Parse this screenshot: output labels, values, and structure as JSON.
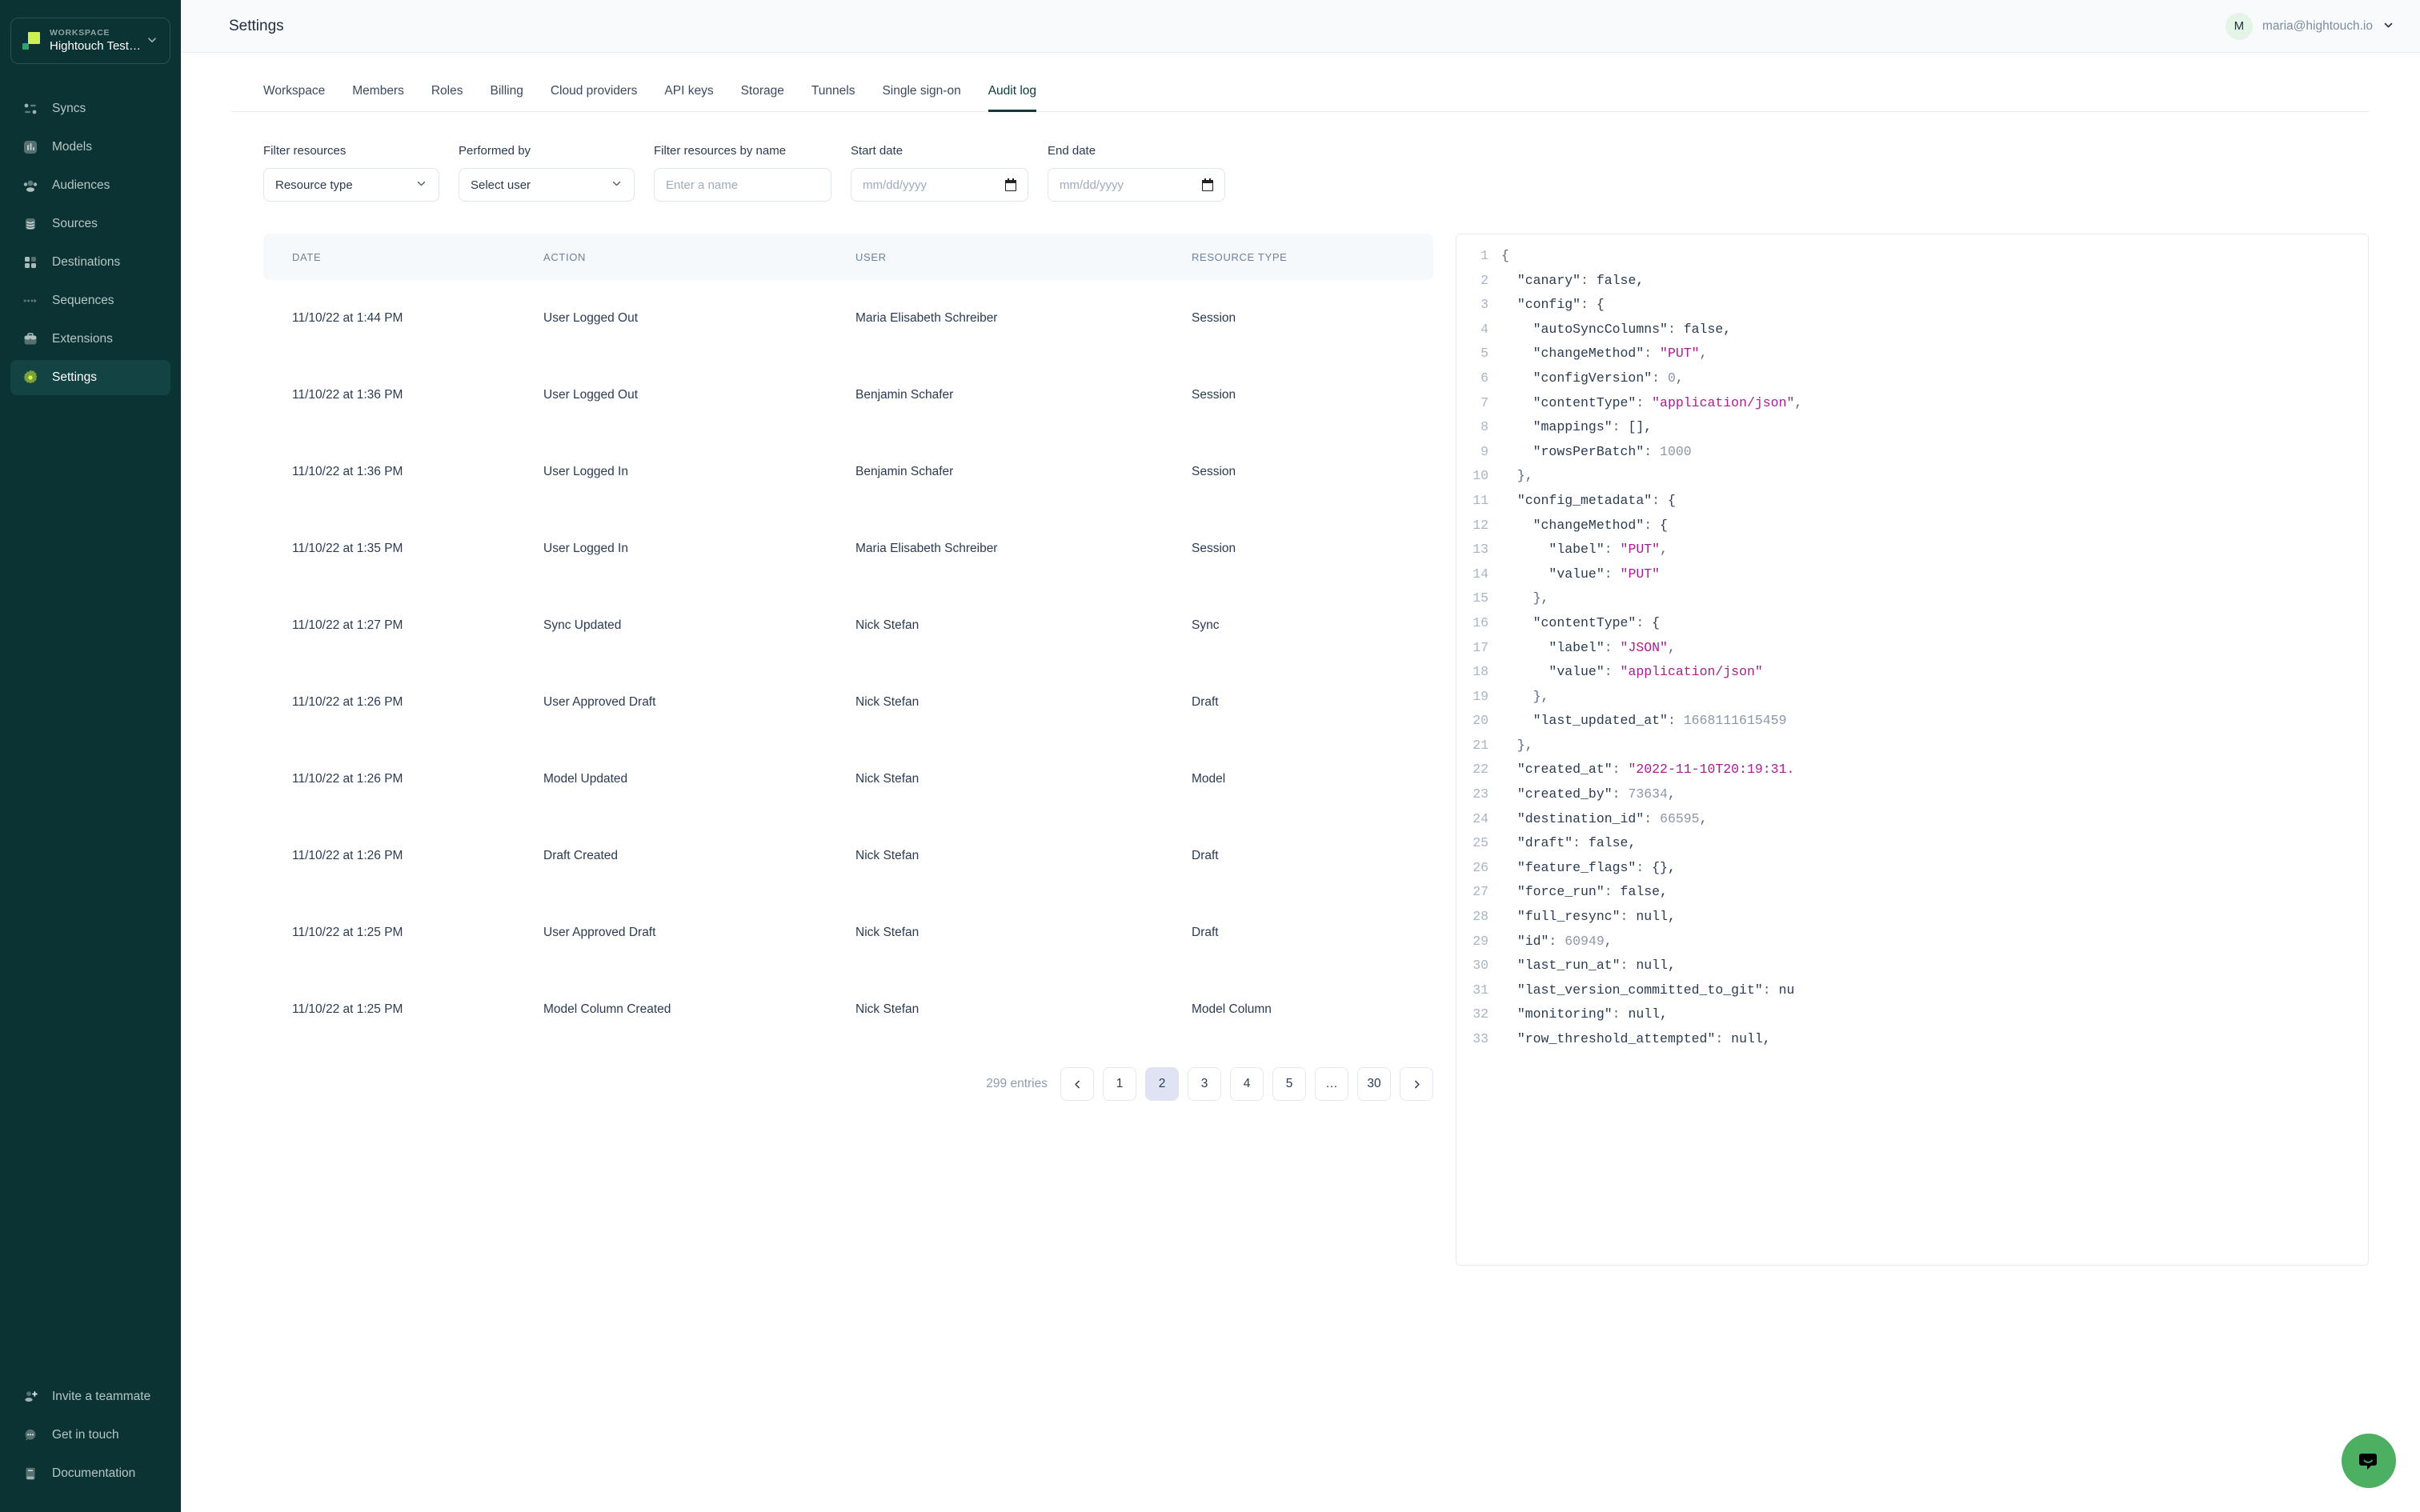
{
  "workspace": {
    "label": "WORKSPACE",
    "name": "Hightouch Testing",
    "chevron": "chevron-down"
  },
  "sidebar": {
    "items": [
      {
        "label": "Syncs",
        "icon": "syncs-icon",
        "active": false
      },
      {
        "label": "Models",
        "icon": "models-icon",
        "active": false
      },
      {
        "label": "Audiences",
        "icon": "audiences-icon",
        "active": false
      },
      {
        "label": "Sources",
        "icon": "sources-icon",
        "active": false
      },
      {
        "label": "Destinations",
        "icon": "destinations-icon",
        "active": false
      },
      {
        "label": "Sequences",
        "icon": "sequences-icon",
        "active": false
      },
      {
        "label": "Extensions",
        "icon": "extensions-icon",
        "active": false
      },
      {
        "label": "Settings",
        "icon": "settings-gear-icon",
        "active": true
      }
    ],
    "bottom_items": [
      {
        "label": "Invite a teammate",
        "icon": "user-plus-icon"
      },
      {
        "label": "Get in touch",
        "icon": "chat-bubble-icon"
      },
      {
        "label": "Documentation",
        "icon": "book-icon"
      }
    ]
  },
  "topbar": {
    "title": "Settings",
    "account": {
      "avatar_initial": "M",
      "email": "maria@hightouch.io"
    }
  },
  "tabs": [
    {
      "label": "Workspace",
      "active": false
    },
    {
      "label": "Members",
      "active": false
    },
    {
      "label": "Roles",
      "active": false
    },
    {
      "label": "Billing",
      "active": false
    },
    {
      "label": "Cloud providers",
      "active": false
    },
    {
      "label": "API keys",
      "active": false
    },
    {
      "label": "Storage",
      "active": false
    },
    {
      "label": "Tunnels",
      "active": false
    },
    {
      "label": "Single sign-on",
      "active": false
    },
    {
      "label": "Audit log",
      "active": true
    }
  ],
  "filters": {
    "resource_type": {
      "label": "Filter resources",
      "value": "Resource type"
    },
    "performed_by": {
      "label": "Performed by",
      "value": "Select user"
    },
    "name": {
      "label": "Filter resources by name",
      "placeholder": "Enter a name",
      "value": ""
    },
    "start_date": {
      "label": "Start date",
      "placeholder": "mm/dd/yyyy",
      "value": ""
    },
    "end_date": {
      "label": "End date",
      "placeholder": "mm/dd/yyyy",
      "value": ""
    }
  },
  "table": {
    "headers": [
      "DATE",
      "ACTION",
      "USER",
      "RESOURCE TYPE"
    ],
    "rows": [
      {
        "date": "11/10/22 at 1:44 PM",
        "action": "User Logged Out",
        "user": "Maria Elisabeth Schreiber",
        "resource_type": "Session"
      },
      {
        "date": "11/10/22 at 1:36 PM",
        "action": "User Logged Out",
        "user": "Benjamin Schafer",
        "resource_type": "Session"
      },
      {
        "date": "11/10/22 at 1:36 PM",
        "action": "User Logged In",
        "user": "Benjamin Schafer",
        "resource_type": "Session"
      },
      {
        "date": "11/10/22 at 1:35 PM",
        "action": "User Logged In",
        "user": "Maria Elisabeth Schreiber",
        "resource_type": "Session"
      },
      {
        "date": "11/10/22 at 1:27 PM",
        "action": "Sync Updated",
        "user": "Nick Stefan",
        "resource_type": "Sync"
      },
      {
        "date": "11/10/22 at 1:26 PM",
        "action": "User Approved Draft",
        "user": "Nick Stefan",
        "resource_type": "Draft"
      },
      {
        "date": "11/10/22 at 1:26 PM",
        "action": "Model Updated",
        "user": "Nick Stefan",
        "resource_type": "Model"
      },
      {
        "date": "11/10/22 at 1:26 PM",
        "action": "Draft Created",
        "user": "Nick Stefan",
        "resource_type": "Draft"
      },
      {
        "date": "11/10/22 at 1:25 PM",
        "action": "User Approved Draft",
        "user": "Nick Stefan",
        "resource_type": "Draft"
      },
      {
        "date": "11/10/22 at 1:25 PM",
        "action": "Model Column Created",
        "user": "Nick Stefan",
        "resource_type": "Model Column"
      }
    ]
  },
  "pagination": {
    "entries_label": "299 entries",
    "prev_icon": "chevron-left-icon",
    "next_icon": "chevron-right-icon",
    "pages": [
      "1",
      "2",
      "3",
      "4",
      "5",
      "…",
      "30"
    ],
    "current": "2"
  },
  "json_viewer": {
    "lines": [
      {
        "n": "1",
        "text": "{"
      },
      {
        "n": "2",
        "text": "  \"canary\": false,"
      },
      {
        "n": "3",
        "text": "  \"config\": {"
      },
      {
        "n": "4",
        "text": "    \"autoSyncColumns\": false,"
      },
      {
        "n": "5",
        "text": "    \"changeMethod\": \"PUT\","
      },
      {
        "n": "6",
        "text": "    \"configVersion\": 0,"
      },
      {
        "n": "7",
        "text": "    \"contentType\": \"application/json\","
      },
      {
        "n": "8",
        "text": "    \"mappings\": [],"
      },
      {
        "n": "9",
        "text": "    \"rowsPerBatch\": 1000"
      },
      {
        "n": "10",
        "text": "  },"
      },
      {
        "n": "11",
        "text": "  \"config_metadata\": {"
      },
      {
        "n": "12",
        "text": "    \"changeMethod\": {"
      },
      {
        "n": "13",
        "text": "      \"label\": \"PUT\","
      },
      {
        "n": "14",
        "text": "      \"value\": \"PUT\""
      },
      {
        "n": "15",
        "text": "    },"
      },
      {
        "n": "16",
        "text": "    \"contentType\": {"
      },
      {
        "n": "17",
        "text": "      \"label\": \"JSON\","
      },
      {
        "n": "18",
        "text": "      \"value\": \"application/json\""
      },
      {
        "n": "19",
        "text": "    },"
      },
      {
        "n": "20",
        "text": "    \"last_updated_at\": 1668111615459"
      },
      {
        "n": "21",
        "text": "  },"
      },
      {
        "n": "22",
        "text": "  \"created_at\": \"2022-11-10T20:19:31."
      },
      {
        "n": "23",
        "text": "  \"created_by\": 73634,"
      },
      {
        "n": "24",
        "text": "  \"destination_id\": 66595,"
      },
      {
        "n": "25",
        "text": "  \"draft\": false,"
      },
      {
        "n": "26",
        "text": "  \"feature_flags\": {},"
      },
      {
        "n": "27",
        "text": "  \"force_run\": false,"
      },
      {
        "n": "28",
        "text": "  \"full_resync\": null,"
      },
      {
        "n": "29",
        "text": "  \"id\": 60949,"
      },
      {
        "n": "30",
        "text": "  \"last_run_at\": null,"
      },
      {
        "n": "31",
        "text": "  \"last_version_committed_to_git\": nu"
      },
      {
        "n": "32",
        "text": "  \"monitoring\": null,"
      },
      {
        "n": "33",
        "text": "  \"row_threshold_attempted\": null,"
      }
    ]
  },
  "chat_widget": {
    "icon": "chat-smile-icon",
    "color": "#4caf62"
  },
  "colors": {
    "sidebar_bg": "#0b3333",
    "accent_green": "#cdf052",
    "tab_active": "#0d3b3b",
    "page_active_bg": "#dfe3f3",
    "string_token": "#a8208f"
  }
}
